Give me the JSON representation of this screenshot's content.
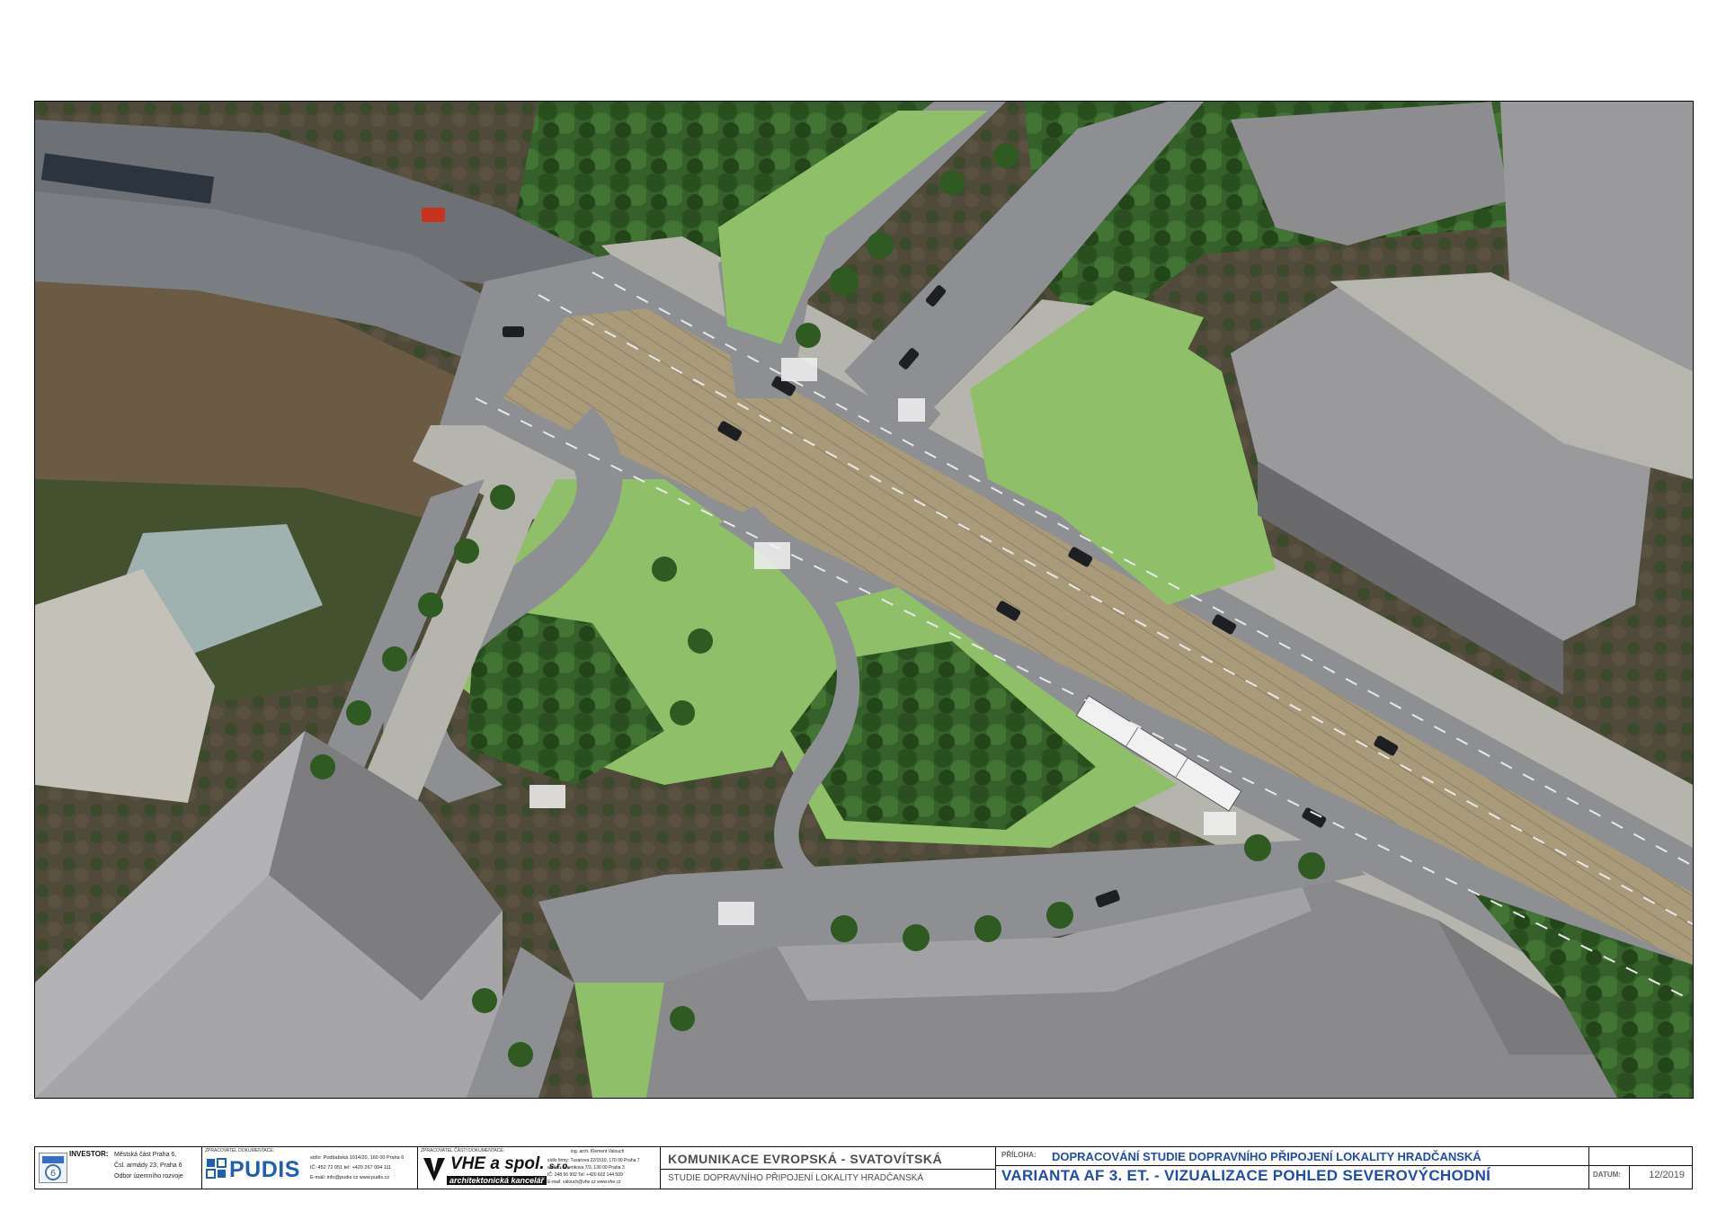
{
  "visualization": {
    "description_icon": "aerial-3d-rendering"
  },
  "title_block": {
    "investor": {
      "label": "INVESTOR:",
      "lines": [
        "Městská část Praha 6,",
        "Čsl. armády 23, Praha 6",
        "Odbor územního rozvoje"
      ],
      "logo_icon": "praha6-logo-icon"
    },
    "pudis": {
      "caption": "ZPRACOVATEL DOKUMENTACE:",
      "name": "PUDIS",
      "addr_lines": [
        "sídlo: Podbabská 1014/20, 160 00 Praha 6",
        "IČ: 452 72 051   tel: +420 267 004 111",
        "E-mail: info@pudis.cz   www.pudis.cz"
      ]
    },
    "vhe": {
      "caption": "ZPRACOVATEL ČÁSTI DOKUMENTACE:",
      "name": "VHE a spol.",
      "suffix": "s.r.o.",
      "tagline": "architektonická kancelář",
      "contact_person": "ing. arch. Klement Valouch",
      "addr_lines": [
        "sídlo firmy: Tusarova 22/1510, 170 00 Praha 7",
        "atelier: Jesenkova 7/3, 130 00 Praha 3",
        "IČ: 248 56 992   Tel: +420 602 144 509",
        "E-mail: valouch@vhe.cz   www.vhe.cz"
      ]
    },
    "project": {
      "title": "KOMUNIKACE EVROPSKÁ - SVATOVÍTSKÁ",
      "subtitle": "STUDIE DOPRAVNÍHO PŘIPOJENÍ LOKALITY HRADČANSKÁ"
    },
    "attachment": {
      "label": "PŘÍLOHA:",
      "study": "DOPRACOVÁNÍ STUDIE DOPRAVNÍHO PŘIPOJENÍ LOKALITY HRADČANSKÁ",
      "variant": "VARIANTA AF 3. ET. - VIZUALIZACE POHLED SEVEROVÝCHODNÍ"
    },
    "date": {
      "label": "DATUM:",
      "value": "12/2019"
    }
  },
  "colors": {
    "road": "#8d8f92",
    "tram_track": "#a99a7a",
    "sidewalk": "#b5b4ad",
    "grass": "#8fbf68",
    "trees": "#2f5a22",
    "building_roof": "#8d8d8f",
    "building_wall": "#6a6a6c",
    "brand_blue": "#1f4ea8"
  }
}
